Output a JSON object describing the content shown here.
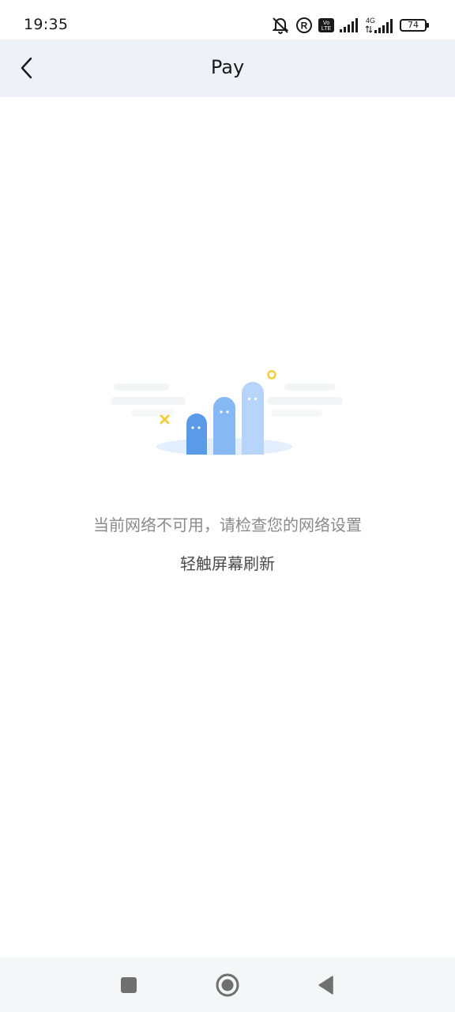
{
  "status_bar": {
    "time": "19:35",
    "battery": "74",
    "network": "4G",
    "volte": "Vo LTE",
    "registered": "R",
    "icons": [
      "mute-icon",
      "registered-icon",
      "volte-icon",
      "signal-icon",
      "signal-4g-icon",
      "battery-icon"
    ]
  },
  "header": {
    "title": "Pay",
    "back_icon": "chevron-left-icon"
  },
  "content": {
    "illustration": "network-error-illustration",
    "error_message": "当前网络不可用，请检查您的网络设置",
    "refresh_hint": "轻触屏幕刷新"
  },
  "nav_bar": {
    "buttons": [
      "recents-square-icon",
      "home-circle-icon",
      "back-triangle-icon"
    ]
  },
  "colors": {
    "header_bg": "#eef1f8",
    "accent_dark_blue": "#5b9ae6",
    "accent_mid_blue": "#86b8f4",
    "accent_light_blue": "#b7d5fb",
    "accent_yellow": "#f0cf3a",
    "error_text": "#8a8a8a",
    "hint_text": "#4a4a4a"
  }
}
